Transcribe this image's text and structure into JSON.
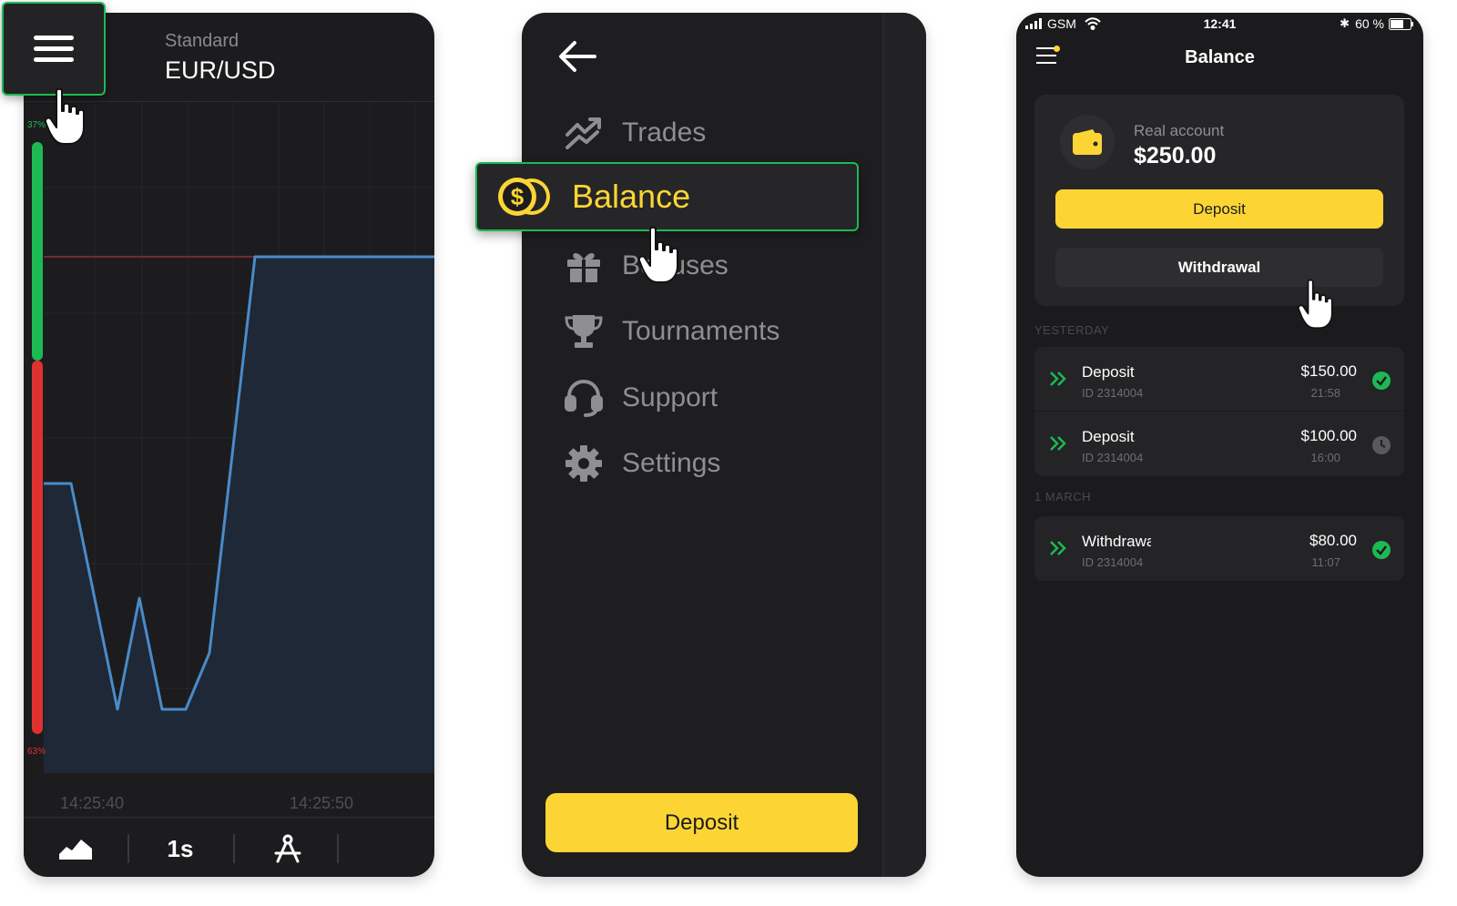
{
  "chart_screen": {
    "asset_type": "Standard",
    "asset_pair": "EUR/USD",
    "up_percent": "37%",
    "down_percent": "63%",
    "time_labels": [
      "14:25:40",
      "14:25:50"
    ],
    "timeframe_label": "1s",
    "icons": [
      "menu-icon",
      "chart-type-icon",
      "drawing-tools-icon"
    ],
    "colors": {
      "up": "#1db954",
      "down": "#e03131",
      "price_line": "#4a8bc9",
      "price_fill": "#1e2836",
      "strike_line": "#a83232"
    }
  },
  "menu_screen": {
    "items": [
      {
        "label": "Trades",
        "icon": "trades-icon"
      },
      {
        "label": "Balance",
        "icon": "coin-dollar-icon",
        "highlighted": true
      },
      {
        "label": "Bonuses",
        "icon": "gift-icon"
      },
      {
        "label": "Tournaments",
        "icon": "trophy-icon"
      },
      {
        "label": "Support",
        "icon": "headset-icon"
      },
      {
        "label": "Settings",
        "icon": "gear-icon"
      }
    ],
    "deposit_label": "Deposit",
    "colors": {
      "accent": "#fcd535",
      "highlight_border": "#1db954"
    }
  },
  "balance_screen": {
    "status": {
      "carrier": "GSM",
      "time": "12:41",
      "battery": "60 %"
    },
    "title": "Balance",
    "account": {
      "label": "Real account",
      "amount": "$250.00"
    },
    "deposit_label": "Deposit",
    "withdrawal_label": "Withdrawal",
    "groups": [
      {
        "heading": "YESTERDAY",
        "transactions": [
          {
            "type": "Deposit",
            "id": "ID 2314004",
            "amount": "$150.00",
            "time": "21:58",
            "status": "completed"
          },
          {
            "type": "Deposit",
            "id": "ID 2314004",
            "amount": "$100.00",
            "time": "16:00",
            "status": "pending"
          }
        ]
      },
      {
        "heading": "1 MARCH",
        "transactions": [
          {
            "type": "Withdrawal",
            "id": "ID 2314004",
            "amount": "$80.00",
            "time": "11:07",
            "status": "completed"
          }
        ]
      }
    ]
  }
}
